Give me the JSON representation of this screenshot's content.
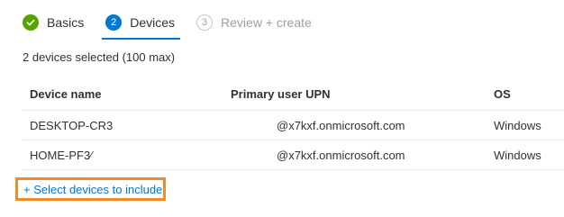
{
  "wizard": {
    "steps": [
      {
        "label": "Basics",
        "state": "completed",
        "icon": "checkmark-icon"
      },
      {
        "label": "Devices",
        "state": "active",
        "number": "2"
      },
      {
        "label": "Review + create",
        "state": "inactive",
        "number": "3"
      }
    ]
  },
  "summary": {
    "selected_text": "2 devices selected (100 max)"
  },
  "table": {
    "columns": [
      "Device name",
      "Primary user UPN",
      "OS"
    ],
    "rows": [
      {
        "device_name": "DESKTOP-CR3",
        "upn": "@x7kxf.onmicrosoft.com",
        "os": "Windows"
      },
      {
        "device_name": "HOME-PF3⁄",
        "upn": "@x7kxf.onmicrosoft.com",
        "os": "Windows"
      }
    ]
  },
  "actions": {
    "select_devices_label": "+ Select devices to include"
  },
  "colors": {
    "accent": "#0078d4",
    "success": "#57a300",
    "highlight": "#f28a28"
  }
}
